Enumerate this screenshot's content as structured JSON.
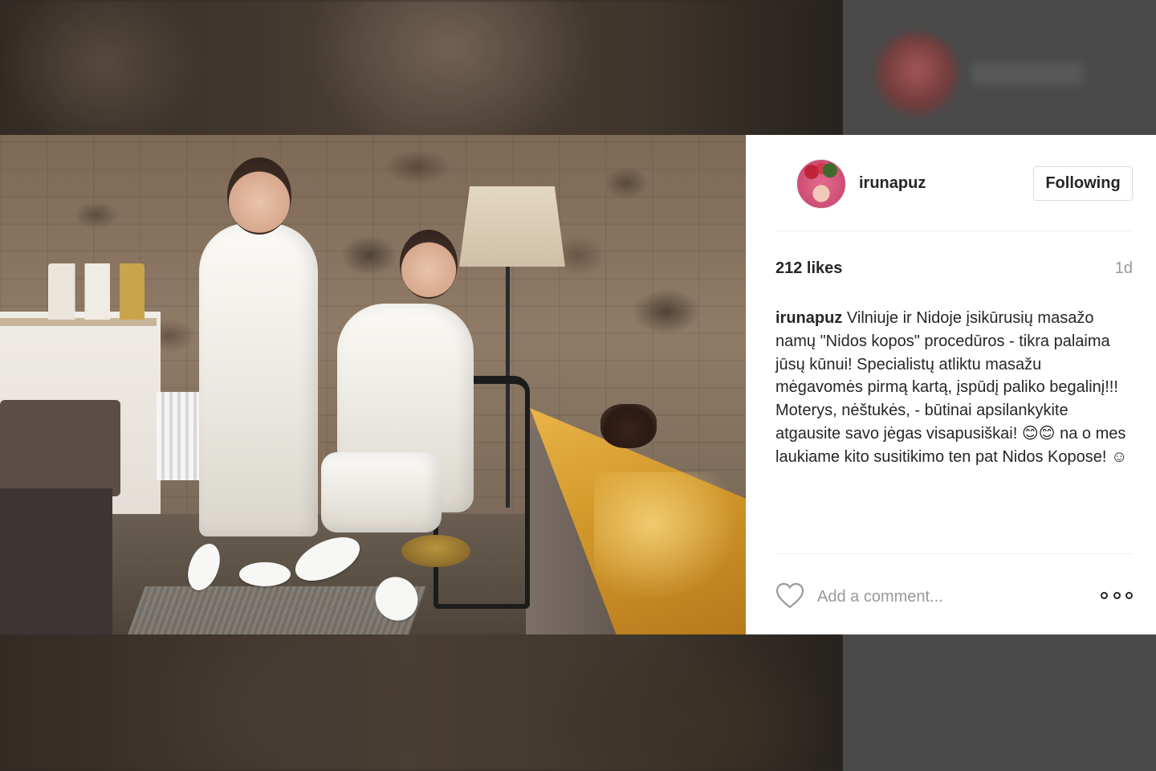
{
  "post": {
    "username": "irunapuz",
    "follow_button": "Following",
    "likes": "212 likes",
    "time": "1d",
    "caption_user": "irunapuz",
    "caption_text": " Vilniuje ir Nidoje įsikūrusių masažo namų \"Nidos kopos\" procedūros - tikra palaima jūsų kūnui! Specialistų atliktu masažu mėgavomės pirmą kartą, įspūdį paliko begalinį!!! Moterys, nėštukės, - būtinai apsilankykite atgausite savo jėgas visapusiškai! 😊😊 na o mes laukiame kito susitikimo ten pat Nidos Kopose! ☺",
    "comment_placeholder": "Add a comment..."
  },
  "icons": {
    "like": "heart-icon",
    "options": "more-options-icon",
    "avatar": "profile-avatar"
  },
  "colors": {
    "text": "#262626",
    "muted": "#999999",
    "border": "#dbdbdb",
    "divider": "#efefef"
  }
}
